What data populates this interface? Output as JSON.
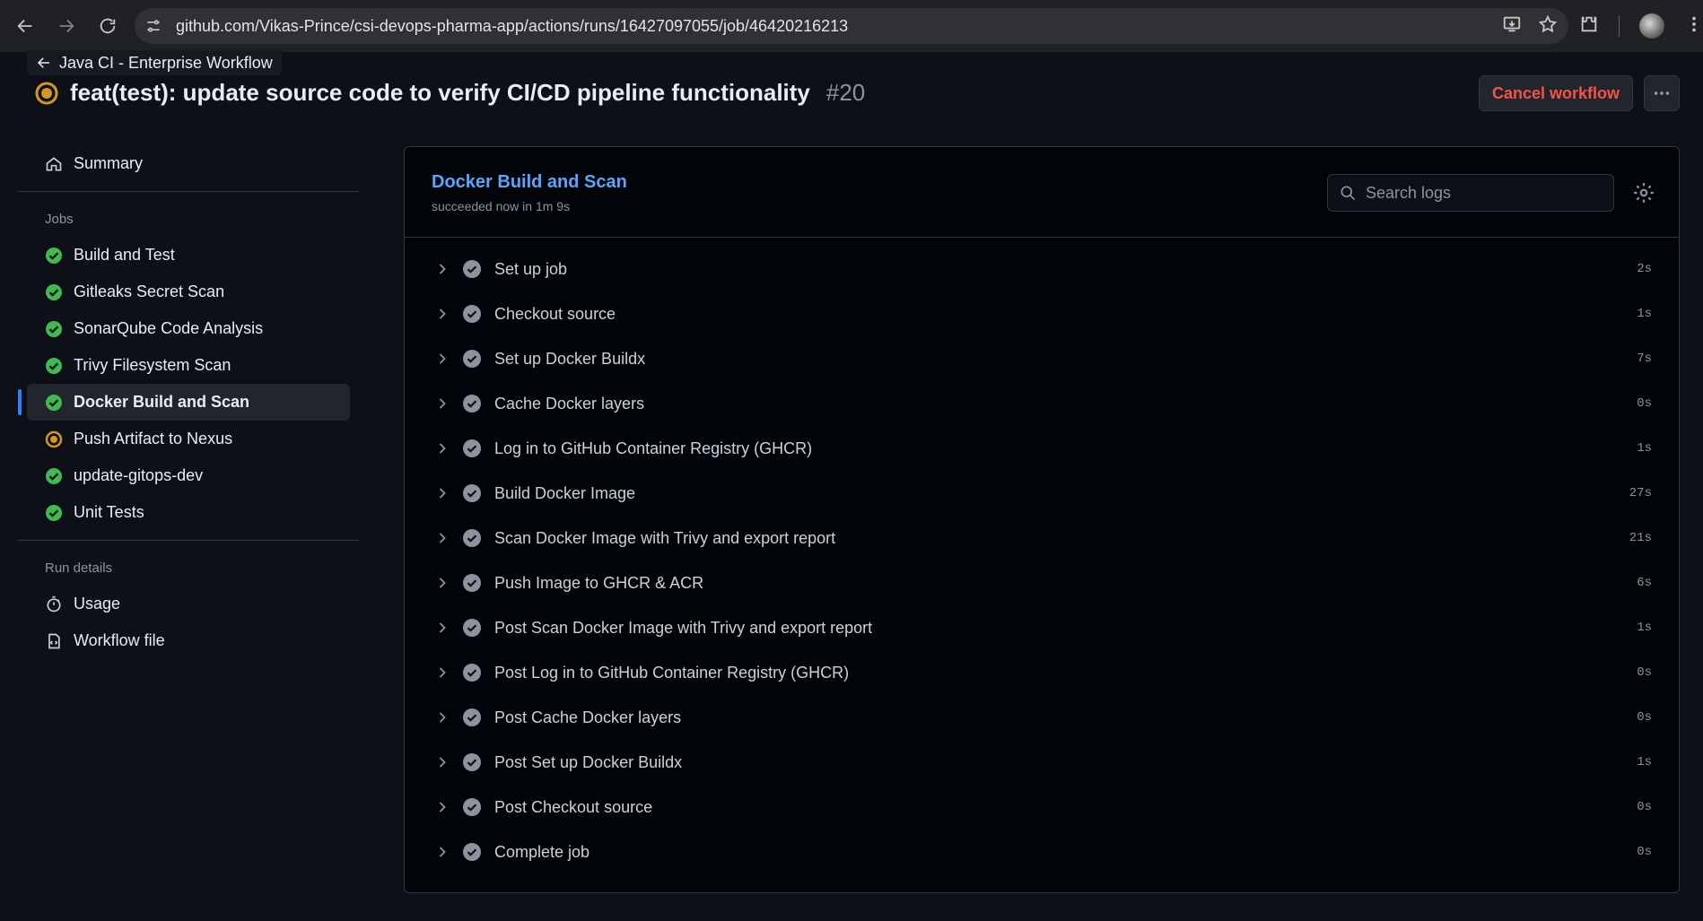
{
  "browser": {
    "url": "github.com/Vikas-Prince/csi-devops-pharma-app/actions/runs/16427097055/job/46420216213"
  },
  "header": {
    "back_label": "Java CI - Enterprise Workflow",
    "run_title": "feat(test): update source code to verify CI/CD pipeline functionality",
    "run_number": "#20",
    "cancel_label": "Cancel workflow"
  },
  "sidebar": {
    "summary_label": "Summary",
    "jobs_heading": "Jobs",
    "jobs": [
      {
        "label": "Build and Test",
        "status": "success"
      },
      {
        "label": "Gitleaks Secret Scan",
        "status": "success"
      },
      {
        "label": "SonarQube Code Analysis",
        "status": "success"
      },
      {
        "label": "Trivy Filesystem Scan",
        "status": "success"
      },
      {
        "label": "Docker Build and Scan",
        "status": "success"
      },
      {
        "label": "Push Artifact to Nexus",
        "status": "in_progress"
      },
      {
        "label": "update-gitops-dev",
        "status": "success"
      },
      {
        "label": "Unit Tests",
        "status": "success"
      }
    ],
    "run_details_heading": "Run details",
    "usage_label": "Usage",
    "workflow_file_label": "Workflow file"
  },
  "job": {
    "title": "Docker Build and Scan",
    "subtitle": "succeeded now in 1m 9s",
    "search_placeholder": "Search logs",
    "steps": [
      {
        "name": "Set up job",
        "duration": "2s"
      },
      {
        "name": "Checkout source",
        "duration": "1s"
      },
      {
        "name": "Set up Docker Buildx",
        "duration": "7s"
      },
      {
        "name": "Cache Docker layers",
        "duration": "0s"
      },
      {
        "name": "Log in to GitHub Container Registry (GHCR)",
        "duration": "1s"
      },
      {
        "name": "Build Docker Image",
        "duration": "27s"
      },
      {
        "name": "Scan Docker Image with Trivy and export report",
        "duration": "21s"
      },
      {
        "name": "Push Image to GHCR & ACR",
        "duration": "6s"
      },
      {
        "name": "Post Scan Docker Image with Trivy and export report",
        "duration": "1s"
      },
      {
        "name": "Post Log in to GitHub Container Registry (GHCR)",
        "duration": "0s"
      },
      {
        "name": "Post Cache Docker layers",
        "duration": "0s"
      },
      {
        "name": "Post Set up Docker Buildx",
        "duration": "1s"
      },
      {
        "name": "Post Checkout source",
        "duration": "0s"
      },
      {
        "name": "Complete job",
        "duration": "0s"
      }
    ]
  },
  "colors": {
    "success": "#3fb950",
    "in_progress": "#d29922",
    "accent": "#58a6ff",
    "danger": "#f85149"
  }
}
